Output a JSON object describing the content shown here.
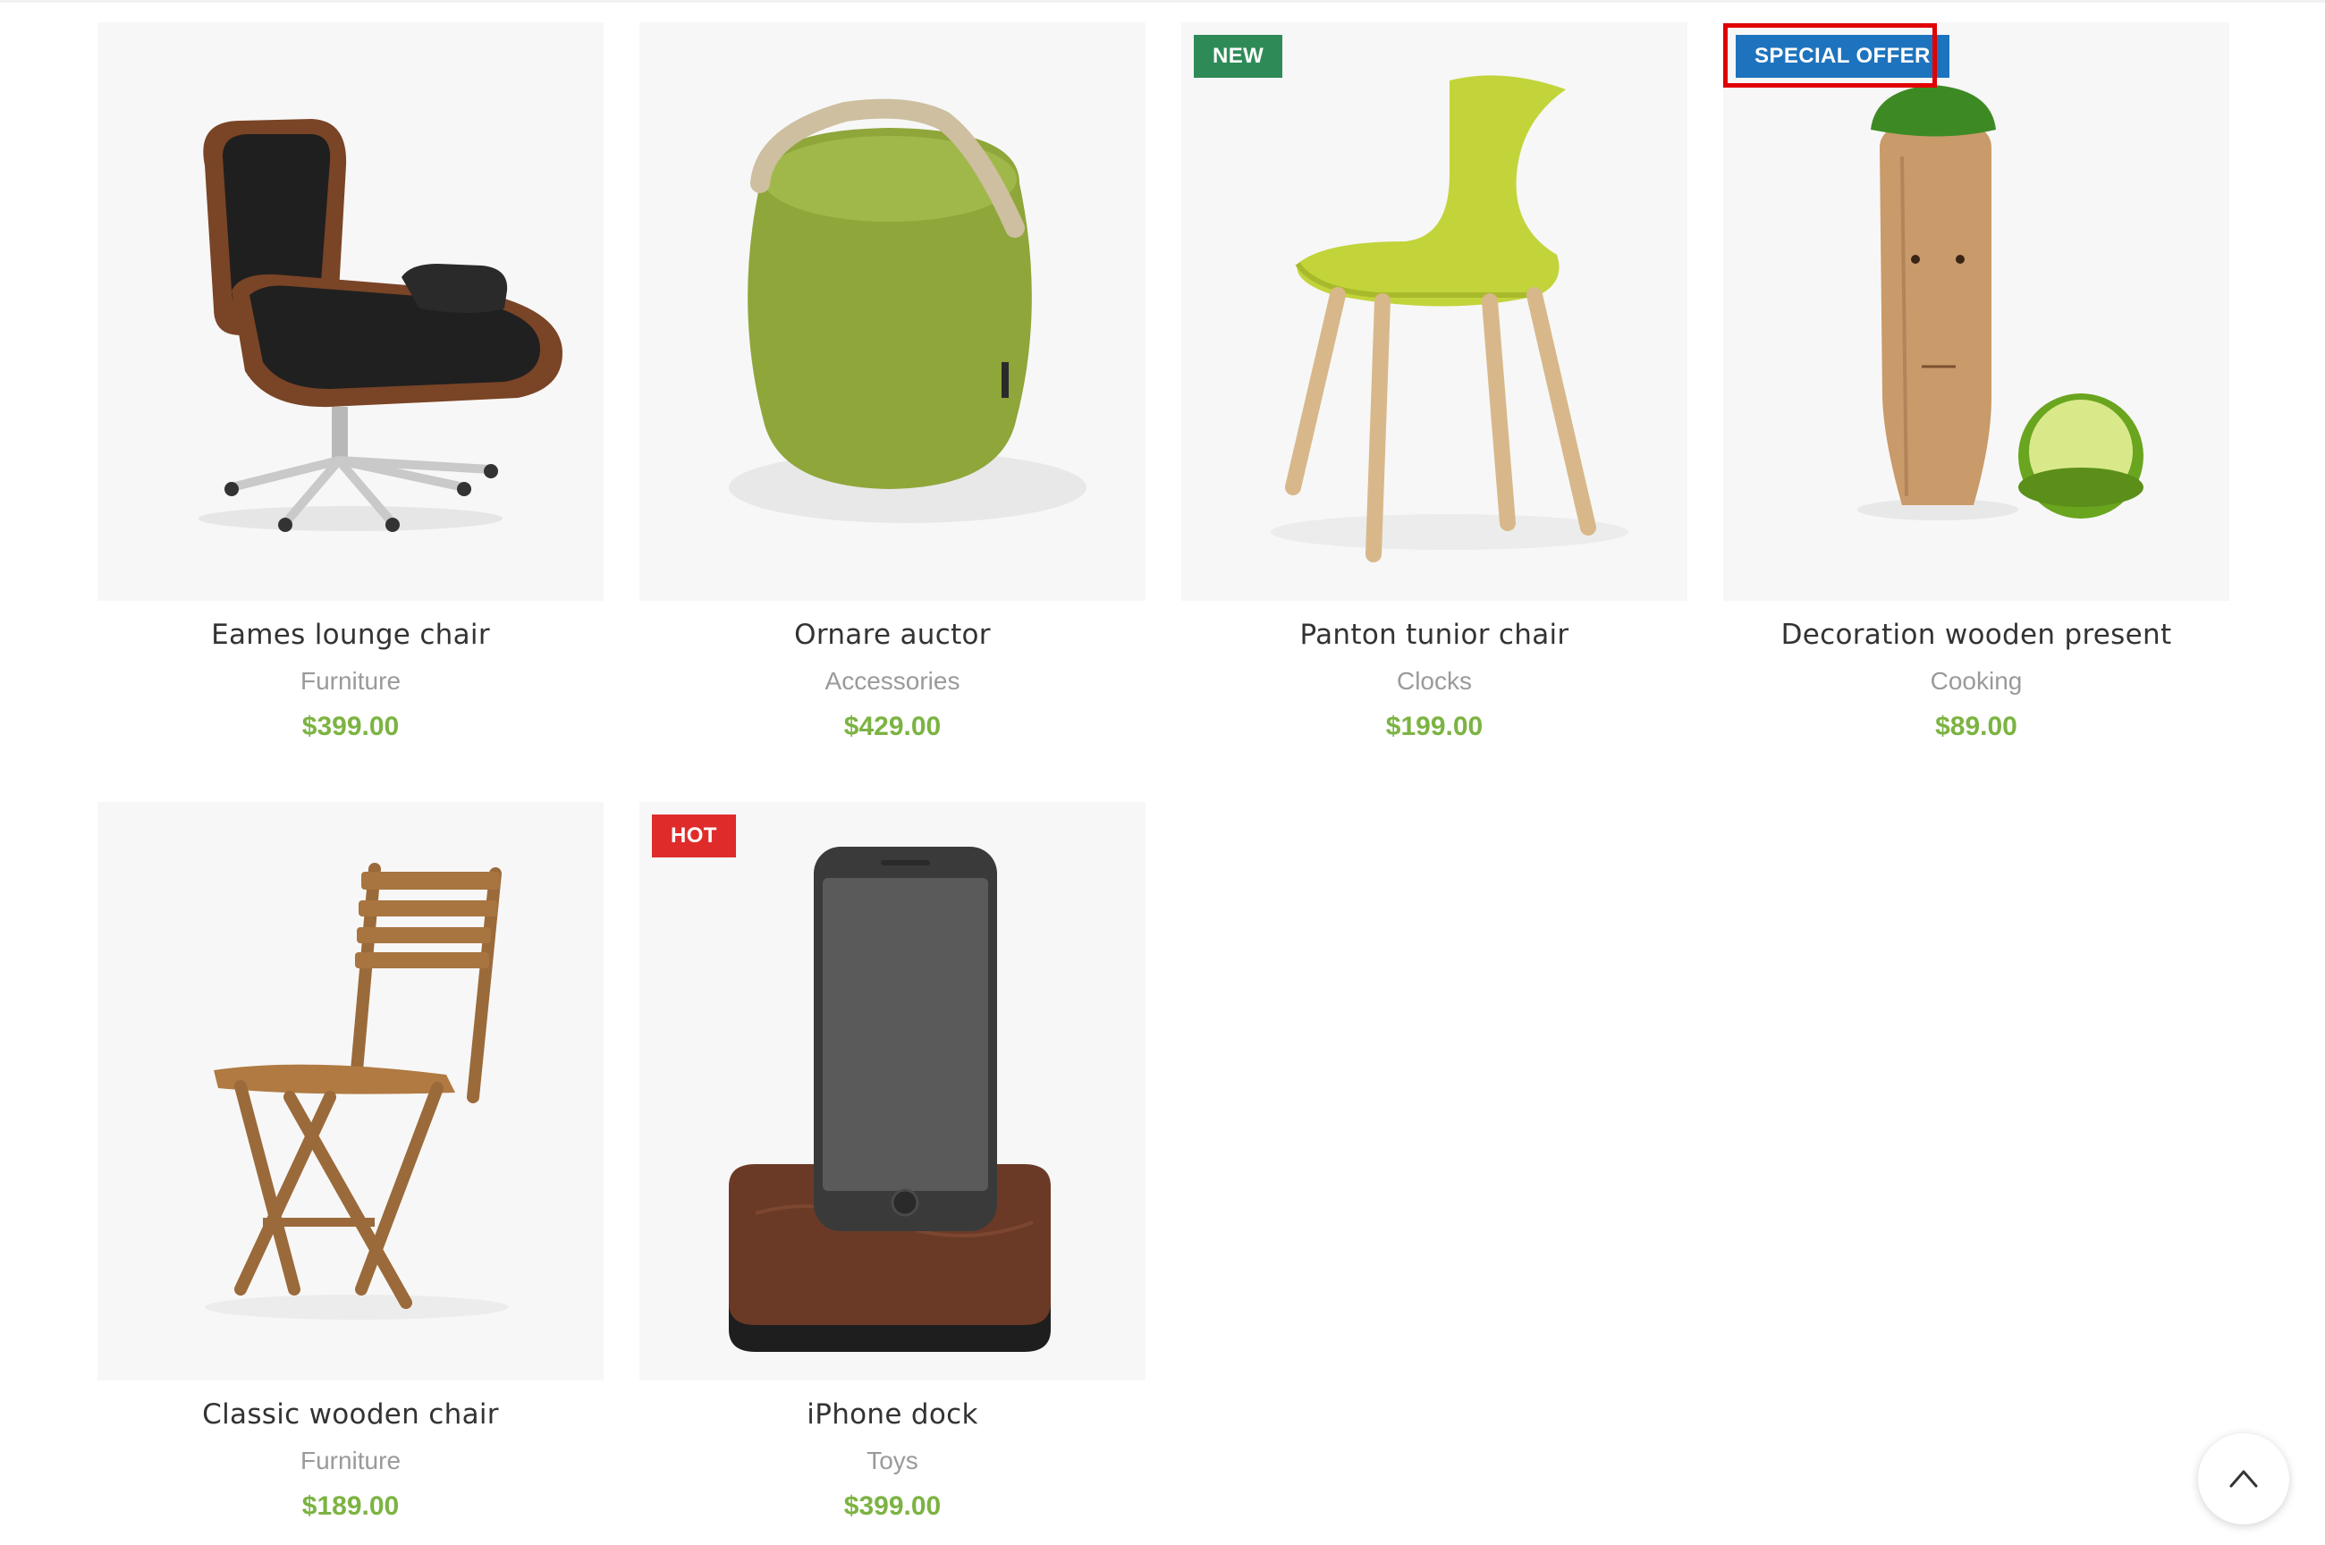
{
  "products": [
    {
      "title": "Eames lounge chair",
      "category": "Furniture",
      "price": "$399.00",
      "badge": "",
      "icon": "lounge-chair-image"
    },
    {
      "title": "Ornare auctor",
      "category": "Accessories",
      "price": "$429.00",
      "badge": "",
      "icon": "pouf-image"
    },
    {
      "title": "Panton tunior chair",
      "category": "Clocks",
      "price": "$199.00",
      "badge": "NEW",
      "icon": "yellow-chair-image"
    },
    {
      "title": "Decoration wooden present",
      "category": "Cooking",
      "price": "$89.00",
      "badge": "SPECIAL OFFER",
      "icon": "wooden-juicer-image"
    },
    {
      "title": "Classic wooden chair",
      "category": "Furniture",
      "price": "$189.00",
      "badge": "",
      "icon": "wooden-chair-image"
    },
    {
      "title": "iPhone dock",
      "category": "Toys",
      "price": "$399.00",
      "badge": "HOT",
      "icon": "phone-dock-image"
    }
  ],
  "colors": {
    "price": "#7cb342",
    "badge_new": "#2e8b57",
    "badge_hot": "#e02b2b",
    "badge_special": "#1e73be",
    "highlight": "#e10000"
  },
  "scroll_top": {
    "icon": "chevron-up-icon"
  }
}
